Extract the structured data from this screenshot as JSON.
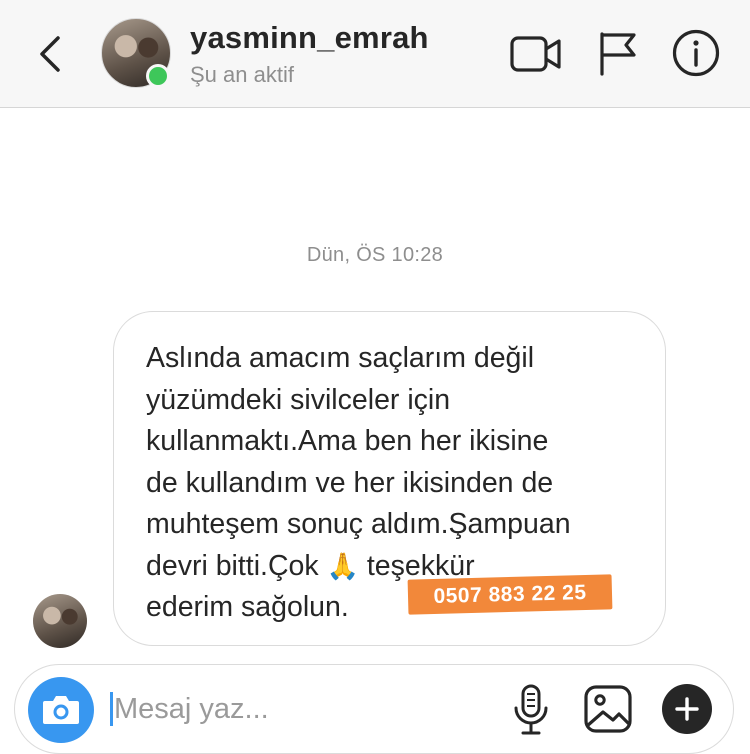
{
  "header": {
    "username": "yasminn_emrah",
    "status": "Şu an aktif",
    "icons": [
      "back-chevron-icon",
      "video-call-icon",
      "flag-icon",
      "info-icon"
    ],
    "active_color": "#3ec75a"
  },
  "thread": {
    "timestamp": "Dün, ÖS 10:28",
    "message": {
      "line1": "Aslında amacım saçlarım değil",
      "line2": "yüzümdeki sivilceler için",
      "line3": "kullanmaktı.Ama ben her ikisine",
      "line4": "de kullandım ve her ikisinden de",
      "line5": "muhteşem sonuç aldım.Şampuan",
      "line6a": "devri bitti.Çok",
      "emoji": "🙏",
      "line6b": "teşekkür",
      "line7": "ederim sağolun."
    },
    "overlay_phone": "0507 883 22 25",
    "overlay_color": "#f2883a"
  },
  "composer": {
    "placeholder": "Mesaj yaz...",
    "value": "",
    "icons": [
      "camera-icon",
      "microphone-icon",
      "gallery-icon",
      "plus-icon"
    ],
    "accent": "#3897f0"
  }
}
